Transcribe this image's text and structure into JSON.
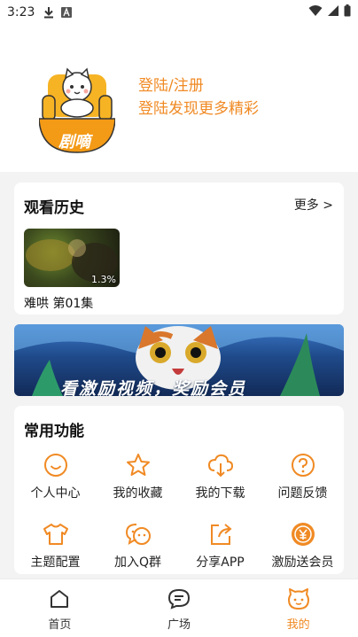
{
  "status_bar": {
    "time": "3:23"
  },
  "header": {
    "logo_text": "剧嘀",
    "login_title": "登陆/注册",
    "login_subtitle": "登陆发现更多精彩"
  },
  "history": {
    "title": "观看历史",
    "more": "更多 >",
    "items": [
      {
        "title": "难哄 第01集",
        "progress": "1.3%"
      }
    ]
  },
  "banner": {
    "text": "看激励视频，奖励会员"
  },
  "functions": {
    "title": "常用功能",
    "items": [
      {
        "label": "个人中心",
        "icon": "smile-icon"
      },
      {
        "label": "我的收藏",
        "icon": "star-icon"
      },
      {
        "label": "我的下载",
        "icon": "cloud-download-icon"
      },
      {
        "label": "问题反馈",
        "icon": "question-icon"
      },
      {
        "label": "主题配置",
        "icon": "shirt-icon"
      },
      {
        "label": "加入Q群",
        "icon": "chat-group-icon"
      },
      {
        "label": "分享APP",
        "icon": "share-icon"
      },
      {
        "label": "激励送会员",
        "icon": "coin-icon"
      }
    ]
  },
  "tab_bar": {
    "tabs": [
      {
        "label": "首页",
        "icon": "home-icon",
        "active": false
      },
      {
        "label": "广场",
        "icon": "square-chat-icon",
        "active": false
      },
      {
        "label": "我的",
        "icon": "profile-face-icon",
        "active": true
      }
    ]
  },
  "colors": {
    "accent": "#f08a24",
    "background": "#f3f3f3"
  }
}
